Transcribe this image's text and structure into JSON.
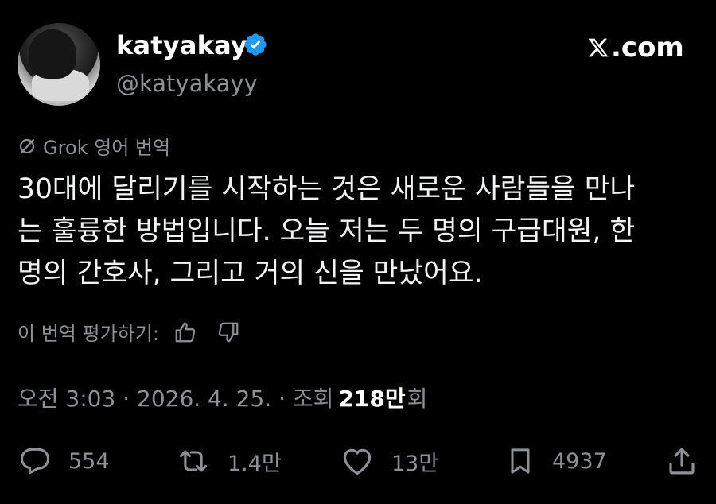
{
  "header": {
    "display_name": "katyakay",
    "handle": "@katyakayy",
    "brand": ".com"
  },
  "translation": {
    "label": "Grok 영어 번역"
  },
  "tweet": {
    "lines": [
      "30대에 달리기를 시작하는 것은 새로운 사람들을 만나",
      "는 훌륭한 방법입니다. 오늘 저는 두 명의 구급대원, 한",
      "명의 간호사, 그리고 거의 신을 만났어요."
    ]
  },
  "rating": {
    "label": "이 번역 평가하기:"
  },
  "meta": {
    "time_date": "오전 3:03 · 2026. 4. 25. · 조회",
    "views": "218만",
    "views_suffix": "회"
  },
  "actions": {
    "replies": "554",
    "reposts": "1.4만",
    "likes": "13만",
    "bookmarks": "4937"
  },
  "colors": {
    "background": "#000000",
    "text": "#e7e9ea",
    "muted": "#8b9197",
    "verified": "#1d9bf0"
  }
}
